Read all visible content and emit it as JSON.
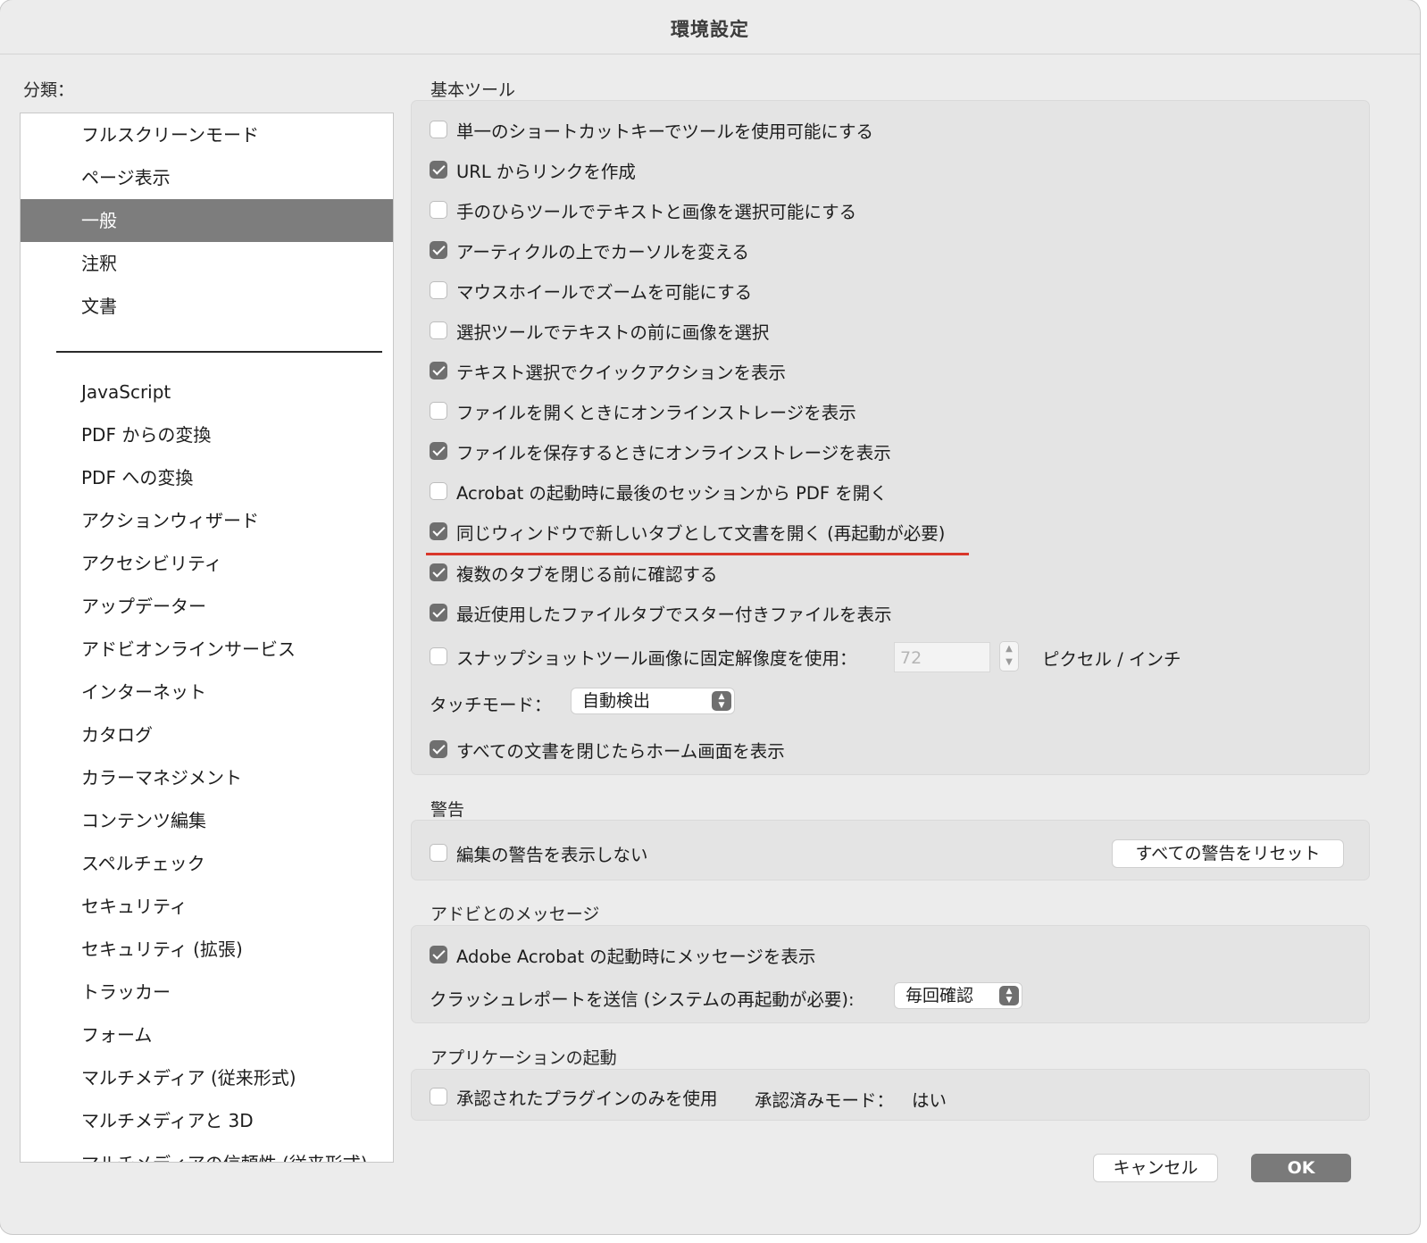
{
  "window": {
    "title": "環境設定"
  },
  "sidebar": {
    "label": "分類：",
    "top_items": [
      "フルスクリーンモード",
      "ページ表示",
      "一般",
      "注釈",
      "文書"
    ],
    "selected": "一般",
    "items": [
      "JavaScript",
      "PDF からの変換",
      "PDF への変換",
      "アクションウィザード",
      "アクセシビリティ",
      "アップデーター",
      "アドビオンラインサービス",
      "インターネット",
      "カタログ",
      "カラーマネジメント",
      "コンテンツ編集",
      "スペルチェック",
      "セキュリティ",
      "セキュリティ (拡張)",
      "トラッカー",
      "フォーム",
      "マルチメディア (従来形式)",
      "マルチメディアと 3D",
      "マルチメディアの信頼性 (従来形式)"
    ]
  },
  "basic_tools": {
    "title": "基本ツール",
    "options": [
      {
        "label": "単一のショートカットキーでツールを使用可能にする",
        "checked": false
      },
      {
        "label": "URL からリンクを作成",
        "checked": true
      },
      {
        "label": "手のひらツールでテキストと画像を選択可能にする",
        "checked": false
      },
      {
        "label": "アーティクルの上でカーソルを変える",
        "checked": true
      },
      {
        "label": "マウスホイールでズームを可能にする",
        "checked": false
      },
      {
        "label": "選択ツールでテキストの前に画像を選択",
        "checked": false
      },
      {
        "label": "テキスト選択でクイックアクションを表示",
        "checked": true
      },
      {
        "label": "ファイルを開くときにオンラインストレージを表示",
        "checked": false
      },
      {
        "label": "ファイルを保存するときにオンラインストレージを表示",
        "checked": true
      },
      {
        "label": "Acrobat の起動時に最後のセッションから PDF を開く",
        "checked": false
      },
      {
        "label": "同じウィンドウで新しいタブとして文書を開く (再起動が必要)",
        "checked": true
      },
      {
        "label": "複数のタブを閉じる前に確認する",
        "checked": true
      },
      {
        "label": "最近使用したファイルタブでスター付きファイルを表示",
        "checked": true
      }
    ],
    "snapshot": {
      "label": "スナップショットツール画像に固定解像度を使用：",
      "checked": false,
      "value": "72",
      "unit": "ピクセル / インチ"
    },
    "touch": {
      "label": "タッチモード：",
      "value": "自動検出"
    },
    "home": {
      "label": "すべての文書を閉じたらホーム画面を表示",
      "checked": true
    }
  },
  "warnings": {
    "title": "警告",
    "option": {
      "label": "編集の警告を表示しない",
      "checked": false
    },
    "reset_button": "すべての警告をリセット"
  },
  "messages": {
    "title": "アドビとのメッセージ",
    "option": {
      "label": "Adobe Acrobat の起動時にメッセージを表示",
      "checked": true
    },
    "crash_label": "クラッシュレポートを送信 (システムの再起動が必要):",
    "crash_value": "毎回確認"
  },
  "startup": {
    "title": "アプリケーションの起動",
    "option": {
      "label": "承認されたプラグインのみを使用",
      "checked": false
    },
    "mode_label": "承認済みモード：",
    "mode_value": "はい"
  },
  "buttons": {
    "cancel": "キャンセル",
    "ok": "OK"
  }
}
